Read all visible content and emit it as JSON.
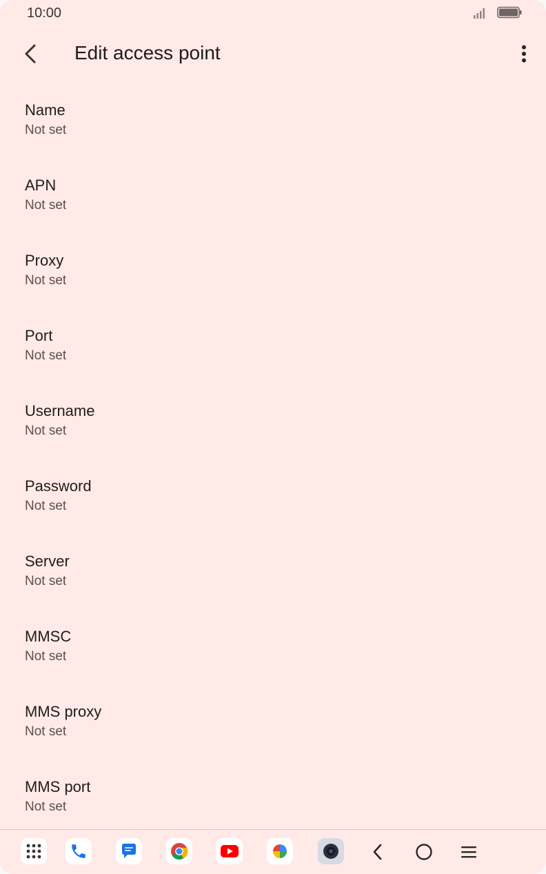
{
  "status_bar": {
    "time": "10:00",
    "signal_icon": "signal-icon",
    "battery_icon": "battery-icon"
  },
  "header": {
    "title": "Edit access point",
    "back_icon": "back-arrow-icon",
    "menu_icon": "more-vert-icon"
  },
  "settings": [
    {
      "label": "Name",
      "value": "Not set"
    },
    {
      "label": "APN",
      "value": "Not set"
    },
    {
      "label": "Proxy",
      "value": "Not set"
    },
    {
      "label": "Port",
      "value": "Not set"
    },
    {
      "label": "Username",
      "value": "Not set"
    },
    {
      "label": "Password",
      "value": "Not set"
    },
    {
      "label": "Server",
      "value": "Not set"
    },
    {
      "label": "MMSC",
      "value": "Not set"
    },
    {
      "label": "MMS proxy",
      "value": "Not set"
    },
    {
      "label": "MMS port",
      "value": "Not set"
    }
  ],
  "taskbar": {
    "apps": [
      "app-drawer-icon",
      "phone-icon",
      "messages-icon",
      "chrome-icon",
      "youtube-icon",
      "photos-icon",
      "camera-icon"
    ],
    "nav": [
      "back-icon",
      "home-icon",
      "recents-icon"
    ]
  },
  "colors": {
    "background": "#ffeae7",
    "text_primary": "#211b1b",
    "text_secondary": "#5a4f4f"
  }
}
